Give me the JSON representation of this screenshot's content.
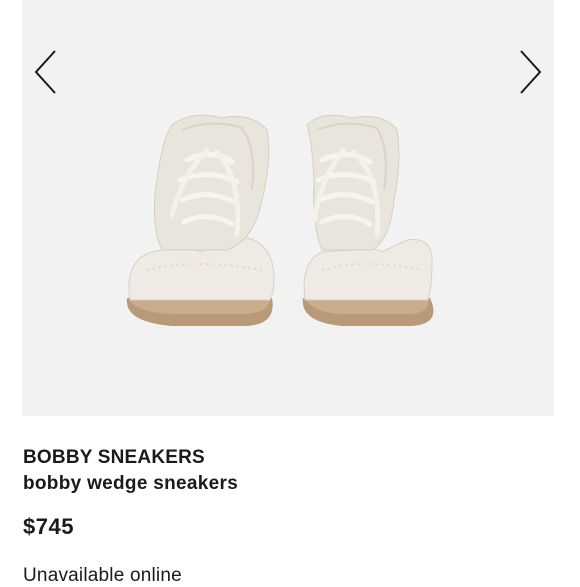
{
  "product": {
    "brand": "BOBBY SNEAKERS",
    "name": "bobby wedge sneakers",
    "price": "$745",
    "availability": "Unavailable online"
  },
  "gallery": {
    "prev_icon": "chevron-left-icon",
    "next_icon": "chevron-right-icon",
    "image_subject": "sneakers-photo"
  },
  "colors": {
    "text": "#1a1a1a",
    "gallery_background": "#f2f2f2",
    "sneaker_upper": "#ebe7df",
    "sneaker_sole": "#b89a78"
  }
}
